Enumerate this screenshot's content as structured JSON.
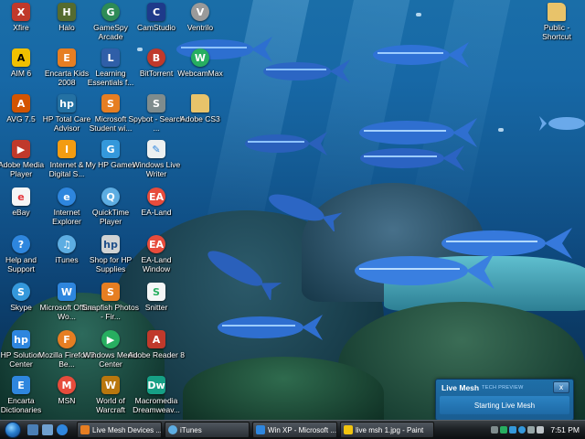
{
  "desktop": {
    "icons": [
      {
        "label": "Xfire",
        "icon": "xfire-icon",
        "color": "#c0392b"
      },
      {
        "label": "Halo",
        "icon": "halo-icon",
        "color": "#556b2f"
      },
      {
        "label": "GameSpy Arcade",
        "icon": "gamespy-icon",
        "color": "#2e8b57"
      },
      {
        "label": "CamStudio",
        "icon": "camstudio-icon",
        "color": "#1e3a8a"
      },
      {
        "label": "Ventrilo",
        "icon": "ventrilo-icon",
        "color": "#9a9a9a"
      },
      {
        "label": "AIM 6",
        "icon": "aim-icon",
        "color": "#f0c000"
      },
      {
        "label": "Encarta Kids 2008",
        "icon": "encarta-kids-icon",
        "color": "#e67e22"
      },
      {
        "label": "Learning Essentials f...",
        "icon": "learning-essentials-icon",
        "color": "#2f5fa8"
      },
      {
        "label": "BitTorrent",
        "icon": "bittorrent-icon",
        "color": "#c0392b"
      },
      {
        "label": "WebcamMax",
        "icon": "webcammax-icon",
        "color": "#27ae60"
      },
      {
        "label": "AVG 7.5",
        "icon": "avg-icon",
        "color": "#d35400"
      },
      {
        "label": "HP Total Care Advisor",
        "icon": "hp-total-care-icon",
        "color": "#2471a3"
      },
      {
        "label": "Microsoft Student wi...",
        "icon": "microsoft-student-icon",
        "color": "#e67e22"
      },
      {
        "label": "Spybot - Search ...",
        "icon": "spybot-icon",
        "color": "#7f8c8d"
      },
      {
        "label": "Adobe CS3",
        "icon": "folder-icon",
        "color": "#e8c36a"
      },
      {
        "label": "Adobe Media Player",
        "icon": "adobe-media-player-icon",
        "color": "#c0392b"
      },
      {
        "label": "Internet & Digital S...",
        "icon": "internet-digital-icon",
        "color": "#f39c12"
      },
      {
        "label": "My HP Games",
        "icon": "hp-games-icon",
        "color": "#3498db"
      },
      {
        "label": "Windows Live Writer",
        "icon": "live-writer-icon",
        "color": "#ecf0f1"
      },
      {
        "label": "eBay",
        "icon": "ebay-icon",
        "color": "#f5f5f5"
      },
      {
        "label": "Internet Explorer",
        "icon": "internet-explorer-icon",
        "color": "#2e86de"
      },
      {
        "label": "QuickTime Player",
        "icon": "quicktime-icon",
        "color": "#5dade2"
      },
      {
        "label": "EA-Land",
        "icon": "ea-land-icon",
        "color": "#e74c3c"
      },
      {
        "label": "Help and Support",
        "icon": "help-icon",
        "color": "#2e86de"
      },
      {
        "label": "iTunes",
        "icon": "itunes-icon",
        "color": "#5dade2"
      },
      {
        "label": "Shop for HP Supplies",
        "icon": "hp-shop-icon",
        "color": "#d0d3d4"
      },
      {
        "label": "EA-Land Window",
        "icon": "ea-land-window-icon",
        "color": "#e74c3c"
      },
      {
        "label": "Skype",
        "icon": "skype-icon",
        "color": "#3498db"
      },
      {
        "label": "Microsoft Office Wo...",
        "icon": "office-word-icon",
        "color": "#2e86de"
      },
      {
        "label": "Snapfish Photos - Fir...",
        "icon": "snapfish-icon",
        "color": "#e67e22"
      },
      {
        "label": "Snitter",
        "icon": "snitter-icon",
        "color": "#f4f6f7"
      },
      {
        "label": "HP Solution Center",
        "icon": "hp-solution-icon",
        "color": "#2e86de"
      },
      {
        "label": "Mozilla Firefox 3 Be...",
        "icon": "firefox-icon",
        "color": "#e67e22"
      },
      {
        "label": "Windows Media Center",
        "icon": "media-center-icon",
        "color": "#27ae60"
      },
      {
        "label": "Adobe Reader 8",
        "icon": "adobe-reader-icon",
        "color": "#c0392b"
      },
      {
        "label": "Encarta Dictionaries",
        "icon": "encarta-dict-icon",
        "color": "#2e86de"
      },
      {
        "label": "MSN",
        "icon": "msn-icon",
        "color": "#e74c3c"
      },
      {
        "label": "World of Warcraft",
        "icon": "warcraft-icon",
        "color": "#b9770e"
      },
      {
        "label": "Macromedia Dreamweav...",
        "icon": "dreamweaver-icon",
        "color": "#16a085"
      },
      {
        "label": "Public - Shortcut",
        "icon": "public-folder-icon",
        "color": "#e8c36a"
      }
    ]
  },
  "taskbar": {
    "tasks": [
      {
        "label": "Live Mesh Devices ...",
        "icon": "live-mesh-task-icon",
        "color": "#e67e22"
      },
      {
        "label": "iTunes",
        "icon": "itunes-task-icon",
        "color": "#5dade2"
      },
      {
        "label": "Win XP - Microsoft ...",
        "icon": "word-task-icon",
        "color": "#2e86de"
      },
      {
        "label": "live msh 1.jpg - Paint",
        "icon": "paint-task-icon",
        "color": "#f1c40f"
      }
    ],
    "clock": "7:51 PM"
  },
  "popup": {
    "title": "Live Mesh",
    "subtitle": "TECH PREVIEW",
    "status": "Starting Live Mesh",
    "close": "x"
  }
}
